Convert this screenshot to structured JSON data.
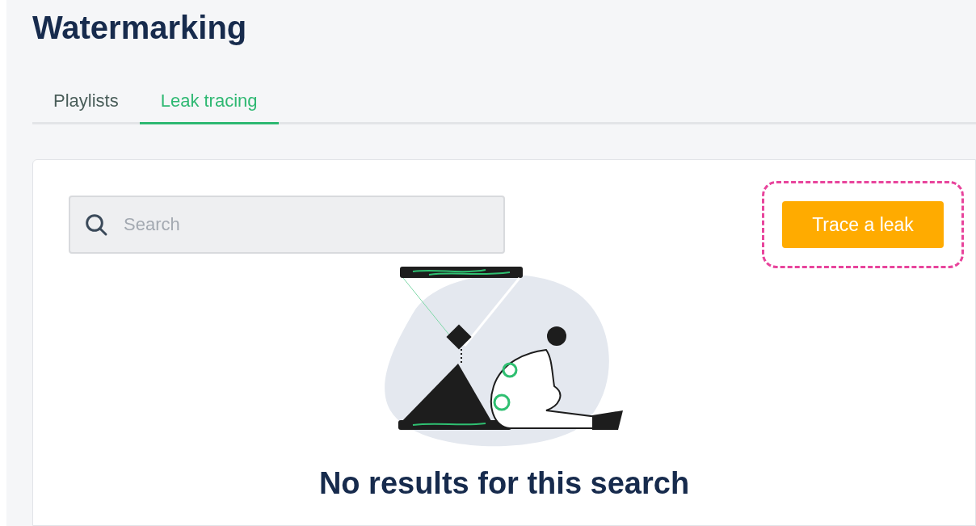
{
  "page": {
    "title": "Watermarking"
  },
  "tabs": [
    {
      "label": "Playlists",
      "selected": false
    },
    {
      "label": "Leak tracing",
      "selected": true
    }
  ],
  "search": {
    "placeholder": "Search"
  },
  "action_button": {
    "label": "Trace a leak",
    "highlighted": true
  },
  "empty_state": {
    "heading": "No results for this search"
  }
}
